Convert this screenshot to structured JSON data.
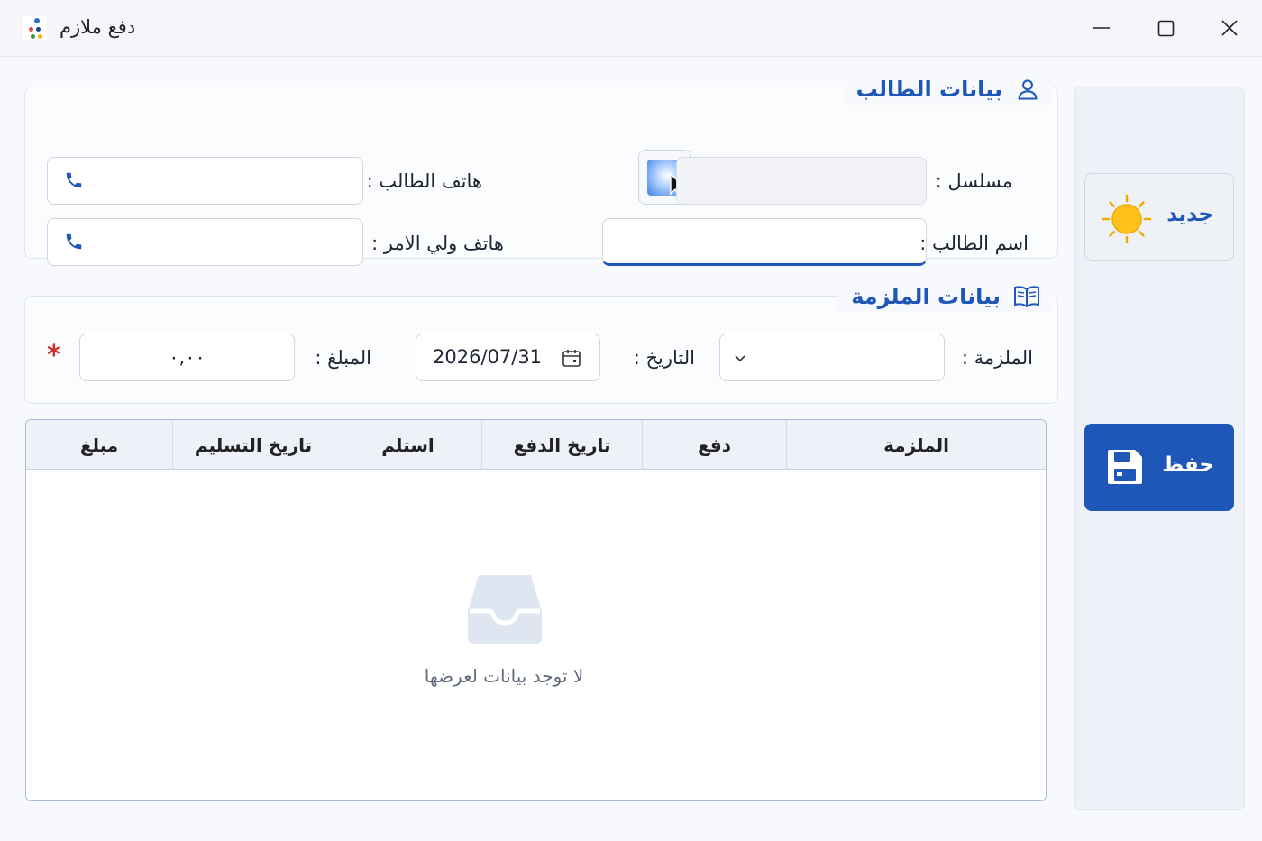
{
  "window": {
    "title": "دفع ملازم"
  },
  "student": {
    "legend": "بيانات الطالب",
    "serial_label": "مسلسل :",
    "serial_value": "",
    "name_label": "اسم الطالب :",
    "name_value": "",
    "phone_label": "هاتف الطالب :",
    "phone_value": "",
    "guardian_phone_label": "هاتف ولي الامر :",
    "guardian_phone_value": ""
  },
  "booklet": {
    "legend": "بيانات الملزمة",
    "booklet_label": "الملزمة :",
    "booklet_value": "",
    "date_label": "التاريخ :",
    "date_value": "2026/07/31",
    "amount_label": "المبلغ :",
    "amount_value": "٠,٠٠",
    "required_mark": "*"
  },
  "table": {
    "columns": [
      "الملزمة",
      "دفع",
      "تاريخ الدفع",
      "استلم",
      "تاريخ التسليم",
      "مبلغ"
    ],
    "rows": [],
    "empty_text": "لا توجد بيانات لعرضها"
  },
  "actions": {
    "new_label": "جديد",
    "save_label": "حفظ"
  },
  "colors": {
    "accent": "#1e57b8",
    "required": "#d32f2f"
  },
  "icons": [
    "app-icon",
    "user-icon",
    "book-icon",
    "phone-icon",
    "calendar-icon",
    "chevron-down-icon",
    "sun-icon",
    "save-icon",
    "inbox-icon"
  ]
}
